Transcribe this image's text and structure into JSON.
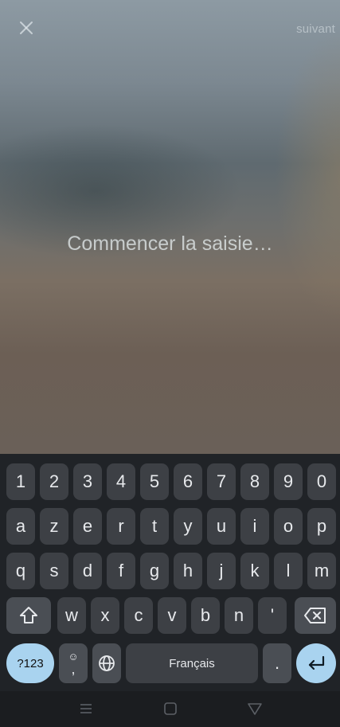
{
  "header": {
    "close_icon": "close-icon",
    "next_label": "suivant"
  },
  "editor": {
    "placeholder": "Commencer la saisie…"
  },
  "keyboard": {
    "number_row": [
      "1",
      "2",
      "3",
      "4",
      "5",
      "6",
      "7",
      "8",
      "9",
      "0"
    ],
    "row1": [
      "a",
      "z",
      "e",
      "r",
      "t",
      "y",
      "u",
      "i",
      "o",
      "p"
    ],
    "row2": [
      "q",
      "s",
      "d",
      "f",
      "g",
      "h",
      "j",
      "k",
      "l",
      "m"
    ],
    "row3": [
      "w",
      "x",
      "c",
      "v",
      "b",
      "n",
      "'"
    ],
    "symbols_label": "?123",
    "space_label": "Français",
    "period_label": ".",
    "comma_label": ","
  },
  "colors": {
    "keyboard_bg": "#202327",
    "key_bg": "#3d4045",
    "accent": "#a9d3ef",
    "caret": "#27c7c0"
  }
}
